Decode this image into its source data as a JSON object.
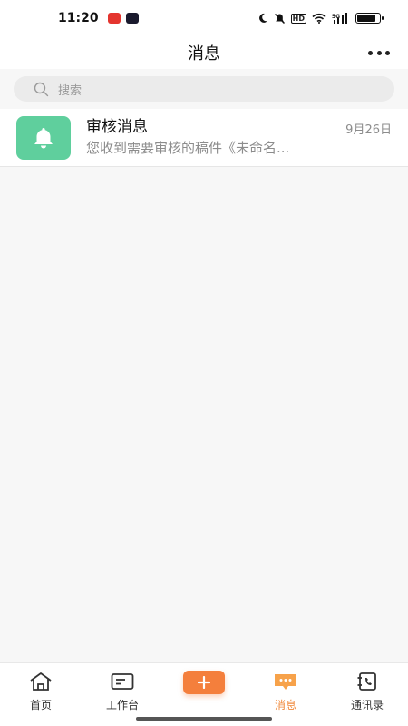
{
  "status_bar": {
    "time": "11:20",
    "battery_level": 0.85,
    "hd_label": "HD",
    "network_label": "5G"
  },
  "header": {
    "title": "消息"
  },
  "search": {
    "placeholder": "搜索"
  },
  "messages": [
    {
      "title": "审核消息",
      "preview": "您收到需要审核的稿件《未命名...",
      "date": "9月26日",
      "icon": "bell-icon",
      "avatar_color": "#5fcf9d"
    }
  ],
  "tabs": [
    {
      "label": "首页",
      "icon": "home-icon"
    },
    {
      "label": "工作台",
      "icon": "workbench-icon"
    },
    {
      "label": "",
      "icon": "plus-icon"
    },
    {
      "label": "消息",
      "icon": "chat-icon",
      "active": true
    },
    {
      "label": "通讯录",
      "icon": "contacts-icon"
    }
  ],
  "colors": {
    "accent": "#f08a3c",
    "add_button": "#f47f3c",
    "avatar_green": "#5fcf9d"
  }
}
